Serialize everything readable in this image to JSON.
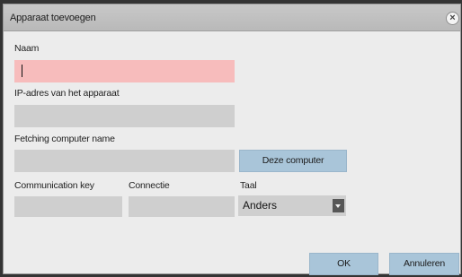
{
  "dialog": {
    "title": "Apparaat toevoegen",
    "close_symbol": "×"
  },
  "form": {
    "name_label": "Naam",
    "name_value": "",
    "ip_label": "IP-adres van het apparaat",
    "ip_value": "",
    "computer_name_label": "Fetching computer name",
    "computer_name_value": "",
    "this_computer_button": "Deze computer",
    "communication_key_label": "Communication key",
    "communication_key_value": "",
    "connection_label": "Connectie",
    "connection_value": "",
    "language_label": "Taal",
    "language_value": "Anders"
  },
  "footer": {
    "ok_label": "OK",
    "cancel_label": "Annuleren"
  },
  "colors": {
    "active_field": "#f7bcbc",
    "field": "#cfcfcf",
    "button": "#a9c5d9"
  },
  "icons": {
    "close": "close-icon",
    "dropdown": "chevron-down-icon"
  }
}
